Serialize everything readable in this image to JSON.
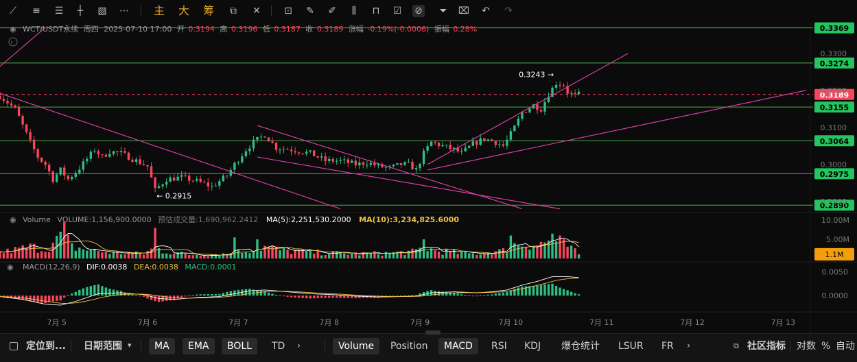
{
  "toolbar": {
    "tools": [
      "trend-line-icon",
      "horizontal-lines-icon",
      "parallel-channel-icon",
      "cross-line-icon",
      "image-icon",
      "more-dots-icon"
    ],
    "text_buttons": [
      "主",
      "大",
      "筹"
    ],
    "right_tools": [
      "crop-icon",
      "ruler-icon",
      "pen-icon",
      "pattern-icon",
      "lock-icon",
      "note-icon",
      "magnet-icon",
      "filter-icon",
      "trash-icon",
      "undo-icon",
      "redo-icon"
    ]
  },
  "info": {
    "symbol": "WCT/USDT永续",
    "weekday": "周四",
    "datetime": "2025-07-10 17:00",
    "open_label": "开",
    "open": "0.3194",
    "high_label": "高",
    "high": "0.3196",
    "low_label": "低",
    "low": "0.3187",
    "close_label": "收",
    "close": "0.3189",
    "change_label": "涨幅",
    "change": "-0.19%(-0.0006)",
    "amp_label": "振幅",
    "amp": "0.28%"
  },
  "volume_info": {
    "title": "Volume",
    "volume": "VOLUME:1,156,900.0000",
    "est": "预估成交量:1,690,962.2412",
    "ma5": "MA(5):2,251,530.2000",
    "ma10": "MA(10):3,234,825.6000"
  },
  "macd_info": {
    "title": "MACD(12,26,9)",
    "dif": "DIF:0.0038",
    "dea": "DEA:0.0038",
    "macd": "MACD:0.0001"
  },
  "colors": {
    "up": "#2ebd85",
    "down": "#f6465d",
    "hline": "#4caf50",
    "trend": "#d63fa0",
    "ma5": "#ffffff",
    "ma10": "#f0c040",
    "dif": "#ffffff",
    "dea": "#f0c040",
    "badge_green": "#22c55e",
    "badge_orange": "#f59e0b"
  },
  "chart_data": {
    "type": "candlestick",
    "price_axis_ticks": [
      "0.3300",
      "0.3200",
      "0.3100",
      "0.3000",
      "0.2900"
    ],
    "price_range": [
      0.287,
      0.3385
    ],
    "horizontal_levels": [
      "0.3369",
      "0.3274",
      "0.3155",
      "0.3064",
      "0.2975",
      "0.2890"
    ],
    "current_price": "0.3189",
    "annotations": [
      {
        "text": "0.3243 →",
        "price": 0.3243
      },
      {
        "text": "← 0.2915",
        "price": 0.2915
      }
    ],
    "volume_axis_ticks": [
      "10.00M",
      "5.00M"
    ],
    "volume_badge": "1.1M",
    "macd_axis_ticks": [
      "0.0050",
      "0.0000"
    ],
    "x_labels": [
      "7月 5",
      "7月 6",
      "7月 7",
      "7月 8",
      "7月 9",
      "7月 10",
      "7月 11",
      "7月 12",
      "7月 13"
    ],
    "x_range": [
      0,
      214
    ],
    "x_label_positions": [
      15,
      39,
      63,
      87,
      111,
      135,
      159,
      183,
      207
    ],
    "candle_count": 154,
    "price_path": [
      [
        0,
        0.3185
      ],
      [
        4,
        0.315
      ],
      [
        8,
        0.306
      ],
      [
        10,
        0.302
      ],
      [
        12,
        0.3
      ],
      [
        14,
        0.296
      ],
      [
        16,
        0.2985
      ],
      [
        18,
        0.296
      ],
      [
        21,
        0.299
      ],
      [
        25,
        0.304
      ],
      [
        27,
        0.302
      ],
      [
        29,
        0.3035
      ],
      [
        32,
        0.303
      ],
      [
        36,
        0.301
      ],
      [
        39,
        0.2995
      ],
      [
        41,
        0.293
      ],
      [
        44,
        0.296
      ],
      [
        48,
        0.2965
      ],
      [
        52,
        0.2955
      ],
      [
        56,
        0.294
      ],
      [
        60,
        0.297
      ],
      [
        62,
        0.3
      ],
      [
        65,
        0.304
      ],
      [
        67,
        0.306
      ],
      [
        70,
        0.308
      ],
      [
        73,
        0.3045
      ],
      [
        77,
        0.304
      ],
      [
        82,
        0.303
      ],
      [
        86,
        0.301
      ],
      [
        90,
        0.301
      ],
      [
        94,
        0.3
      ],
      [
        97,
        0.3005
      ],
      [
        100,
        0.2995
      ],
      [
        103,
        0.299
      ],
      [
        106,
        0.3
      ],
      [
        108,
        0.3
      ],
      [
        110,
        0.2985
      ],
      [
        112,
        0.303
      ],
      [
        114,
        0.306
      ],
      [
        117,
        0.305
      ],
      [
        120,
        0.304
      ],
      [
        122,
        0.303
      ],
      [
        125,
        0.3055
      ],
      [
        128,
        0.307
      ],
      [
        131,
        0.306
      ],
      [
        133,
        0.305
      ],
      [
        134,
        0.3065
      ],
      [
        136,
        0.31
      ],
      [
        138,
        0.314
      ],
      [
        141,
        0.316
      ],
      [
        143,
        0.315
      ],
      [
        145,
        0.319
      ],
      [
        147,
        0.322
      ],
      [
        149,
        0.3215
      ],
      [
        150,
        0.3195
      ],
      [
        152,
        0.3185
      ],
      [
        153,
        0.3189
      ]
    ],
    "volume_path": [
      [
        0,
        1.5
      ],
      [
        8,
        3.0
      ],
      [
        12,
        2.5
      ],
      [
        15,
        4.5
      ],
      [
        17,
        6.0
      ],
      [
        19,
        3.0
      ],
      [
        25,
        2.0
      ],
      [
        30,
        1.5
      ],
      [
        38,
        1.2
      ],
      [
        41,
        3.0
      ],
      [
        43,
        2.0
      ],
      [
        50,
        1.0
      ],
      [
        60,
        1.2
      ],
      [
        62,
        1.6
      ],
      [
        65,
        2.0
      ],
      [
        67,
        2.5
      ],
      [
        70,
        3.0
      ],
      [
        75,
        2.0
      ],
      [
        85,
        1.5
      ],
      [
        95,
        1.2
      ],
      [
        105,
        1.5
      ],
      [
        110,
        1.8
      ],
      [
        112,
        3.0
      ],
      [
        115,
        2.0
      ],
      [
        125,
        1.2
      ],
      [
        133,
        2.0
      ],
      [
        135,
        3.5
      ],
      [
        140,
        4.0
      ],
      [
        142,
        3.5
      ],
      [
        145,
        4.5
      ],
      [
        150,
        3.2
      ],
      [
        153,
        1.1
      ]
    ],
    "volume_spikes": [
      [
        16,
        7.0
      ],
      [
        17,
        9.5
      ],
      [
        41,
        8.0
      ],
      [
        62,
        5.5
      ],
      [
        68,
        5.0
      ],
      [
        112,
        5.0
      ],
      [
        135,
        6.0
      ],
      [
        146,
        6.5
      ],
      [
        148,
        6.0
      ]
    ],
    "macd_path": [
      [
        0,
        -0.0002
      ],
      [
        6,
        -0.0008
      ],
      [
        12,
        -0.0018
      ],
      [
        16,
        -0.002
      ],
      [
        20,
        -0.0012
      ],
      [
        26,
        0.0004
      ],
      [
        32,
        0.0006
      ],
      [
        38,
        0.0002
      ],
      [
        42,
        -0.0006
      ],
      [
        46,
        -0.0008
      ],
      [
        52,
        -0.0004
      ],
      [
        58,
        -0.0002
      ],
      [
        62,
        0.0004
      ],
      [
        66,
        0.001
      ],
      [
        70,
        0.0012
      ],
      [
        76,
        0.0008
      ],
      [
        82,
        0.0004
      ],
      [
        88,
        0.0002
      ],
      [
        94,
        -0.0001
      ],
      [
        100,
        -0.0003
      ],
      [
        106,
        -0.0002
      ],
      [
        110,
        -0.0001
      ],
      [
        114,
        0.0006
      ],
      [
        120,
        0.0008
      ],
      [
        126,
        0.0006
      ],
      [
        130,
        0.0008
      ],
      [
        134,
        0.0012
      ],
      [
        138,
        0.0022
      ],
      [
        142,
        0.003
      ],
      [
        146,
        0.004
      ],
      [
        150,
        0.004
      ],
      [
        153,
        0.0038
      ]
    ],
    "macd_range": [
      -0.003,
      0.0068
    ],
    "volume_range": [
      0,
      12
    ],
    "trend_lines": [
      [
        [
          0,
          0.3192
        ],
        [
          90,
          0.288
        ]
      ],
      [
        [
          0,
          0.3265
        ],
        [
          12,
          0.337
        ]
      ],
      [
        [
          68,
          0.3105
        ],
        [
          138,
          0.288
        ]
      ],
      [
        [
          68,
          0.302
        ],
        [
          148,
          0.288
        ]
      ],
      [
        [
          113,
          0.3
        ],
        [
          166,
          0.33
        ]
      ],
      [
        [
          113,
          0.2985
        ],
        [
          213,
          0.32
        ]
      ]
    ]
  },
  "bottombar": {
    "locate": "定位到...",
    "date_range": "日期范围",
    "ind_main": [
      "MA",
      "EMA",
      "BOLL",
      "TD"
    ],
    "ind_sub": [
      "Volume",
      "Position",
      "MACD",
      "RSI",
      "KDJ",
      "爆仓统计",
      "LSUR",
      "FR"
    ],
    "community": "社区指标",
    "right": [
      "对数",
      "%",
      "自动"
    ]
  }
}
